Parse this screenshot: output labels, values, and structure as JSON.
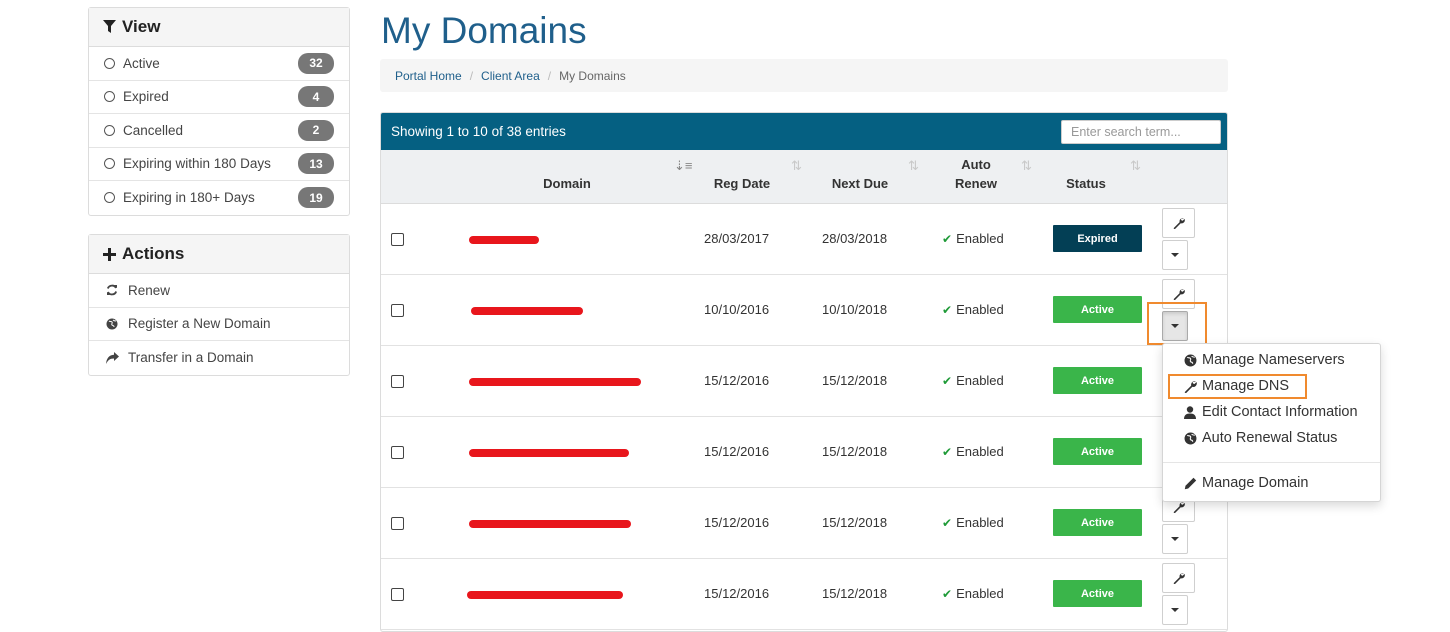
{
  "sidebar": {
    "view": {
      "title": "View",
      "items": [
        {
          "label": "Active",
          "count": "32"
        },
        {
          "label": "Expired",
          "count": "4"
        },
        {
          "label": "Cancelled",
          "count": "2"
        },
        {
          "label": "Expiring within 180 Days",
          "count": "13"
        },
        {
          "label": "Expiring in 180+ Days",
          "count": "19"
        }
      ]
    },
    "actions": {
      "title": "Actions",
      "items": [
        {
          "label": "Renew",
          "icon": "refresh-icon"
        },
        {
          "label": "Register a New Domain",
          "icon": "globe-icon"
        },
        {
          "label": "Transfer in a Domain",
          "icon": "share-arrow-icon"
        }
      ]
    }
  },
  "page": {
    "title": "My Domains",
    "breadcrumb": [
      "Portal Home",
      "Client Area",
      "My Domains"
    ]
  },
  "table": {
    "showing": "Showing 1 to 10 of 38 entries",
    "search_placeholder": "Enter search term...",
    "columns": {
      "domain": "Domain",
      "reg_date": "Reg Date",
      "next_due": "Next Due",
      "auto_renew_line1": "Auto",
      "auto_renew_line2": "Renew",
      "status": "Status"
    },
    "rows": [
      {
        "reg_date": "28/03/2017",
        "next_due": "28/03/2018",
        "auto_renew": "Enabled",
        "status": "Expired"
      },
      {
        "reg_date": "10/10/2016",
        "next_due": "10/10/2018",
        "auto_renew": "Enabled",
        "status": "Active"
      },
      {
        "reg_date": "15/12/2016",
        "next_due": "15/12/2018",
        "auto_renew": "Enabled",
        "status": "Active"
      },
      {
        "reg_date": "15/12/2016",
        "next_due": "15/12/2018",
        "auto_renew": "Enabled",
        "status": "Active"
      },
      {
        "reg_date": "15/12/2016",
        "next_due": "15/12/2018",
        "auto_renew": "Enabled",
        "status": "Active"
      },
      {
        "reg_date": "15/12/2016",
        "next_due": "15/12/2018",
        "auto_renew": "Enabled",
        "status": "Active"
      }
    ]
  },
  "dropdown": {
    "items": [
      {
        "label": "Manage Nameservers",
        "icon": "globe-icon"
      },
      {
        "label": "Manage DNS",
        "icon": "wrench-icon"
      },
      {
        "label": "Edit Contact Information",
        "icon": "user-icon"
      },
      {
        "label": "Auto Renewal Status",
        "icon": "globe-icon"
      },
      {
        "label": "Manage Domain",
        "icon": "pencil-icon"
      }
    ]
  },
  "colors": {
    "title": "#1f5f8b",
    "table_header": "#056082",
    "status_active": "#3ab54a",
    "status_expired": "#033f55",
    "highlight": "#f08a2e",
    "enabled_check": "#1e9a37"
  }
}
